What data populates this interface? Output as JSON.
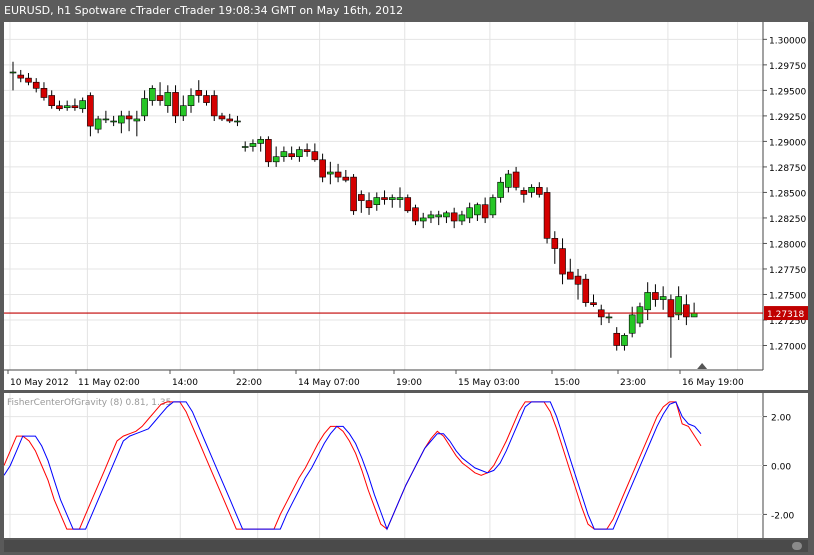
{
  "window": {
    "title": "EURUSD, h1 Spotware cTrader cTrader 19:08:34 GMT on May 16th, 2012"
  },
  "colors": {
    "bull": "#26c626",
    "bear": "#d40000",
    "current_price_line": "#c00000",
    "fisher": "#0000ff",
    "trigger": "#ff0000",
    "grid": "#e4e4e4"
  },
  "indicator": {
    "label": "FisherCenterOfGravity (8) 0.81, 1.35",
    "y_ticks": [
      "2.00",
      "0.00",
      "-2.00"
    ]
  },
  "price_axis": {
    "ticks": [
      "1.30000",
      "1.29750",
      "1.29500",
      "1.29250",
      "1.29000",
      "1.28750",
      "1.28500",
      "1.28250",
      "1.28000",
      "1.27750",
      "1.27500",
      "1.27250",
      "1.27000"
    ],
    "current_price": "1.27318"
  },
  "time_axis": {
    "labels": [
      "10 May 2012",
      "11 May 02:00",
      "14:00",
      "22:00",
      "14 May 07:00",
      "19:00",
      "15 May 03:00",
      "15:00",
      "23:00",
      "16 May 19:00"
    ]
  },
  "chart_data": {
    "type": "candlestick",
    "timeframe": "h1",
    "symbol": "EURUSD",
    "ylim": [
      1.2676,
      1.3017
    ],
    "current_price": 1.27318,
    "candles": [
      {
        "o": 1.2968,
        "h": 1.2978,
        "l": 1.295,
        "c": 1.2968
      },
      {
        "o": 1.2965,
        "h": 1.297,
        "l": 1.2958,
        "c": 1.2962
      },
      {
        "o": 1.2962,
        "h": 1.2967,
        "l": 1.2955,
        "c": 1.2958
      },
      {
        "o": 1.2958,
        "h": 1.2962,
        "l": 1.2948,
        "c": 1.2952
      },
      {
        "o": 1.2952,
        "h": 1.2958,
        "l": 1.294,
        "c": 1.2943
      },
      {
        "o": 1.2945,
        "h": 1.295,
        "l": 1.2932,
        "c": 1.2935
      },
      {
        "o": 1.2935,
        "h": 1.294,
        "l": 1.293,
        "c": 1.2932
      },
      {
        "o": 1.2933,
        "h": 1.294,
        "l": 1.293,
        "c": 1.2935
      },
      {
        "o": 1.2935,
        "h": 1.2942,
        "l": 1.293,
        "c": 1.2933
      },
      {
        "o": 1.2932,
        "h": 1.2943,
        "l": 1.2928,
        "c": 1.294
      },
      {
        "o": 1.2945,
        "h": 1.2948,
        "l": 1.2905,
        "c": 1.2915
      },
      {
        "o": 1.2912,
        "h": 1.2925,
        "l": 1.2908,
        "c": 1.2922
      },
      {
        "o": 1.2922,
        "h": 1.293,
        "l": 1.2918,
        "c": 1.2922
      },
      {
        "o": 1.292,
        "h": 1.2925,
        "l": 1.2915,
        "c": 1.292
      },
      {
        "o": 1.2918,
        "h": 1.293,
        "l": 1.2908,
        "c": 1.2925
      },
      {
        "o": 1.2925,
        "h": 1.293,
        "l": 1.291,
        "c": 1.2922
      },
      {
        "o": 1.292,
        "h": 1.293,
        "l": 1.2905,
        "c": 1.2922
      },
      {
        "o": 1.2925,
        "h": 1.295,
        "l": 1.292,
        "c": 1.2942
      },
      {
        "o": 1.294,
        "h": 1.2955,
        "l": 1.2935,
        "c": 1.2952
      },
      {
        "o": 1.2945,
        "h": 1.2958,
        "l": 1.2935,
        "c": 1.294
      },
      {
        "o": 1.2935,
        "h": 1.2955,
        "l": 1.2928,
        "c": 1.2948
      },
      {
        "o": 1.2948,
        "h": 1.2955,
        "l": 1.2918,
        "c": 1.2925
      },
      {
        "o": 1.2925,
        "h": 1.2945,
        "l": 1.292,
        "c": 1.2935
      },
      {
        "o": 1.2935,
        "h": 1.2952,
        "l": 1.2928,
        "c": 1.2945
      },
      {
        "o": 1.295,
        "h": 1.296,
        "l": 1.2938,
        "c": 1.2945
      },
      {
        "o": 1.2945,
        "h": 1.295,
        "l": 1.2935,
        "c": 1.2938
      },
      {
        "o": 1.2945,
        "h": 1.295,
        "l": 1.292,
        "c": 1.2925
      },
      {
        "o": 1.2925,
        "h": 1.2928,
        "l": 1.292,
        "c": 1.2922
      },
      {
        "o": 1.2922,
        "h": 1.2927,
        "l": 1.2918,
        "c": 1.292
      },
      {
        "o": 1.292,
        "h": 1.2925,
        "l": 1.2915,
        "c": 1.292
      },
      {
        "o": 1.2895,
        "h": 1.29,
        "l": 1.289,
        "c": 1.2895
      },
      {
        "o": 1.2895,
        "h": 1.2902,
        "l": 1.289,
        "c": 1.2898
      },
      {
        "o": 1.2898,
        "h": 1.2905,
        "l": 1.289,
        "c": 1.2902
      },
      {
        "o": 1.2902,
        "h": 1.2905,
        "l": 1.2875,
        "c": 1.288
      },
      {
        "o": 1.288,
        "h": 1.2895,
        "l": 1.2875,
        "c": 1.2885
      },
      {
        "o": 1.2885,
        "h": 1.2895,
        "l": 1.288,
        "c": 1.289
      },
      {
        "o": 1.2888,
        "h": 1.2895,
        "l": 1.2882,
        "c": 1.2885
      },
      {
        "o": 1.2885,
        "h": 1.2895,
        "l": 1.288,
        "c": 1.2892
      },
      {
        "o": 1.2892,
        "h": 1.2898,
        "l": 1.2885,
        "c": 1.289
      },
      {
        "o": 1.289,
        "h": 1.2898,
        "l": 1.288,
        "c": 1.2882
      },
      {
        "o": 1.2882,
        "h": 1.2888,
        "l": 1.286,
        "c": 1.2865
      },
      {
        "o": 1.2868,
        "h": 1.288,
        "l": 1.2858,
        "c": 1.287
      },
      {
        "o": 1.287,
        "h": 1.2878,
        "l": 1.286,
        "c": 1.2865
      },
      {
        "o": 1.2865,
        "h": 1.2872,
        "l": 1.286,
        "c": 1.2862
      },
      {
        "o": 1.2865,
        "h": 1.2868,
        "l": 1.2828,
        "c": 1.2832
      },
      {
        "o": 1.2848,
        "h": 1.2852,
        "l": 1.283,
        "c": 1.2842
      },
      {
        "o": 1.2842,
        "h": 1.285,
        "l": 1.2828,
        "c": 1.2835
      },
      {
        "o": 1.2838,
        "h": 1.285,
        "l": 1.2832,
        "c": 1.2845
      },
      {
        "o": 1.2845,
        "h": 1.2852,
        "l": 1.2838,
        "c": 1.2843
      },
      {
        "o": 1.2843,
        "h": 1.2848,
        "l": 1.2835,
        "c": 1.2845
      },
      {
        "o": 1.2843,
        "h": 1.2855,
        "l": 1.2835,
        "c": 1.2845
      },
      {
        "o": 1.2845,
        "h": 1.2848,
        "l": 1.283,
        "c": 1.2832
      },
      {
        "o": 1.2835,
        "h": 1.2838,
        "l": 1.2818,
        "c": 1.2822
      },
      {
        "o": 1.2822,
        "h": 1.283,
        "l": 1.2815,
        "c": 1.2825
      },
      {
        "o": 1.2825,
        "h": 1.2832,
        "l": 1.282,
        "c": 1.2828
      },
      {
        "o": 1.2826,
        "h": 1.2832,
        "l": 1.2818,
        "c": 1.2828
      },
      {
        "o": 1.2826,
        "h": 1.2832,
        "l": 1.282,
        "c": 1.283
      },
      {
        "o": 1.283,
        "h": 1.2835,
        "l": 1.2815,
        "c": 1.2822
      },
      {
        "o": 1.2822,
        "h": 1.2832,
        "l": 1.2818,
        "c": 1.2828
      },
      {
        "o": 1.2825,
        "h": 1.284,
        "l": 1.282,
        "c": 1.2835
      },
      {
        "o": 1.2828,
        "h": 1.284,
        "l": 1.2822,
        "c": 1.2838
      },
      {
        "o": 1.2838,
        "h": 1.2845,
        "l": 1.282,
        "c": 1.2825
      },
      {
        "o": 1.2828,
        "h": 1.2848,
        "l": 1.2825,
        "c": 1.2845
      },
      {
        "o": 1.2845,
        "h": 1.2865,
        "l": 1.284,
        "c": 1.286
      },
      {
        "o": 1.2855,
        "h": 1.2872,
        "l": 1.285,
        "c": 1.2868
      },
      {
        "o": 1.287,
        "h": 1.2875,
        "l": 1.2852,
        "c": 1.2855
      },
      {
        "o": 1.2852,
        "h": 1.2855,
        "l": 1.284,
        "c": 1.2848
      },
      {
        "o": 1.285,
        "h": 1.2858,
        "l": 1.2845,
        "c": 1.2855
      },
      {
        "o": 1.2855,
        "h": 1.286,
        "l": 1.2845,
        "c": 1.2848
      },
      {
        "o": 1.285,
        "h": 1.2855,
        "l": 1.28,
        "c": 1.2805
      },
      {
        "o": 1.2805,
        "h": 1.2812,
        "l": 1.278,
        "c": 1.2795
      },
      {
        "o": 1.2795,
        "h": 1.2805,
        "l": 1.276,
        "c": 1.277
      },
      {
        "o": 1.2772,
        "h": 1.2785,
        "l": 1.2765,
        "c": 1.2765
      },
      {
        "o": 1.2768,
        "h": 1.2775,
        "l": 1.2745,
        "c": 1.276
      },
      {
        "o": 1.2765,
        "h": 1.277,
        "l": 1.2738,
        "c": 1.2742
      },
      {
        "o": 1.2742,
        "h": 1.275,
        "l": 1.2738,
        "c": 1.274
      },
      {
        "o": 1.2735,
        "h": 1.274,
        "l": 1.272,
        "c": 1.2728
      },
      {
        "o": 1.2728,
        "h": 1.2732,
        "l": 1.2722,
        "c": 1.2728
      },
      {
        "o": 1.2712,
        "h": 1.2718,
        "l": 1.2695,
        "c": 1.27
      },
      {
        "o": 1.27,
        "h": 1.2712,
        "l": 1.2695,
        "c": 1.271
      },
      {
        "o": 1.2712,
        "h": 1.2738,
        "l": 1.2708,
        "c": 1.273
      },
      {
        "o": 1.2722,
        "h": 1.2742,
        "l": 1.2718,
        "c": 1.2738
      },
      {
        "o": 1.2735,
        "h": 1.2762,
        "l": 1.2725,
        "c": 1.2752
      },
      {
        "o": 1.2752,
        "h": 1.276,
        "l": 1.2738,
        "c": 1.2745
      },
      {
        "o": 1.2745,
        "h": 1.2758,
        "l": 1.2735,
        "c": 1.2748
      },
      {
        "o": 1.2745,
        "h": 1.275,
        "l": 1.2688,
        "c": 1.2728
      },
      {
        "o": 1.273,
        "h": 1.2758,
        "l": 1.2725,
        "c": 1.2748
      },
      {
        "o": 1.274,
        "h": 1.275,
        "l": 1.272,
        "c": 1.2728
      },
      {
        "o": 1.2728,
        "h": 1.2742,
        "l": 1.2728,
        "c": 1.2732
      }
    ],
    "indicator": {
      "name": "FisherCenterOfGravity",
      "ylim": [
        -2.8,
        2.8
      ],
      "fisher_color": "blue",
      "trigger_color": "red",
      "fisher": [
        -0.4,
        0.0,
        0.6,
        1.2,
        1.2,
        1.2,
        0.8,
        0.2,
        -0.6,
        -1.4,
        -2.0,
        -2.6,
        -2.6,
        -2.6,
        -2.0,
        -1.4,
        -0.8,
        -0.2,
        0.4,
        1.0,
        1.2,
        1.3,
        1.4,
        1.5,
        1.8,
        2.1,
        2.4,
        2.6,
        2.6,
        2.6,
        2.2,
        1.6,
        1.0,
        0.4,
        -0.2,
        -0.8,
        -1.4,
        -2.0,
        -2.6,
        -2.6,
        -2.6,
        -2.6,
        -2.6,
        -2.6,
        -2.6,
        -2.0,
        -1.5,
        -1.0,
        -0.5,
        -0.1,
        0.4,
        0.9,
        1.3,
        1.6,
        1.6,
        1.3,
        0.9,
        0.3,
        -0.4,
        -1.2,
        -1.9,
        -2.6,
        -2.0,
        -1.4,
        -0.8,
        -0.3,
        0.2,
        0.7,
        1.0,
        1.3,
        1.3,
        1.0,
        0.6,
        0.3,
        0.1,
        -0.1,
        -0.2,
        -0.3,
        -0.2,
        0.1,
        0.6,
        1.2,
        1.8,
        2.4,
        2.6,
        2.6,
        2.6,
        2.6,
        2.0,
        1.2,
        0.4,
        -0.4,
        -1.2,
        -2.0,
        -2.6,
        -2.6,
        -2.6,
        -2.6,
        -2.0,
        -1.4,
        -0.8,
        -0.2,
        0.4,
        1.0,
        1.6,
        2.1,
        2.5,
        2.6,
        2.0,
        1.7,
        1.6,
        1.3
      ],
      "trigger": [
        0.0,
        0.6,
        1.2,
        1.2,
        1.0,
        0.6,
        0.0,
        -0.6,
        -1.4,
        -2.0,
        -2.6,
        -2.6,
        -2.6,
        -2.0,
        -1.4,
        -0.8,
        -0.2,
        0.4,
        1.0,
        1.2,
        1.3,
        1.4,
        1.6,
        1.9,
        2.2,
        2.5,
        2.6,
        2.6,
        2.6,
        2.2,
        1.6,
        1.0,
        0.4,
        -0.2,
        -0.8,
        -1.4,
        -2.0,
        -2.6,
        -2.6,
        -2.6,
        -2.6,
        -2.6,
        -2.6,
        -2.6,
        -2.0,
        -1.5,
        -1.0,
        -0.5,
        -0.1,
        0.4,
        0.9,
        1.3,
        1.6,
        1.6,
        1.4,
        1.0,
        0.5,
        -0.2,
        -1.0,
        -1.7,
        -2.4,
        -2.6,
        -2.0,
        -1.4,
        -0.8,
        -0.3,
        0.2,
        0.7,
        1.1,
        1.4,
        1.2,
        0.8,
        0.4,
        0.1,
        -0.1,
        -0.3,
        -0.4,
        -0.3,
        0.0,
        0.5,
        1.0,
        1.6,
        2.2,
        2.6,
        2.6,
        2.6,
        2.6,
        2.2,
        1.5,
        0.7,
        -0.1,
        -0.9,
        -1.7,
        -2.4,
        -2.6,
        -2.6,
        -2.6,
        -2.2,
        -1.6,
        -1.0,
        -0.4,
        0.2,
        0.8,
        1.4,
        2.0,
        2.4,
        2.6,
        2.6,
        1.7,
        1.6,
        1.2,
        0.8
      ]
    }
  }
}
